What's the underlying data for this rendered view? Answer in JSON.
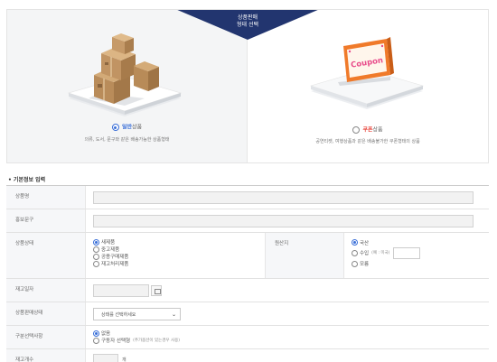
{
  "selection": {
    "banner_line1": "상품판매",
    "banner_line2": "형태 선택",
    "general": {
      "label_highlight": "일반",
      "label_rest": "상품",
      "selected": true,
      "description": "의류, 도서, 문구와 같은 배송가능한 상품형태"
    },
    "coupon": {
      "label_highlight": "쿠폰",
      "label_rest": "상품",
      "selected": false,
      "sign_text": "Coupon",
      "description": "공연티켓, 여행상품과 같은 배송불가한 쿠폰형태의 상품"
    }
  },
  "basic_info": {
    "section_title": "• 기본정보 입력",
    "product_name": {
      "label": "상품명",
      "value": ""
    },
    "promo_text": {
      "label": "홍보문구",
      "value": ""
    },
    "product_state": {
      "label": "상품상태",
      "options": [
        "새제품",
        "중고제품",
        "공용구매제품",
        "재고처리제품"
      ],
      "selected": "새제품"
    },
    "origin": {
      "label": "원산지",
      "options": [
        "국산",
        "수입",
        "모름"
      ],
      "import_hint": "(예 : 미국)",
      "selected": "국산"
    },
    "restock_date": {
      "label": "재고일자",
      "value": ""
    },
    "product_status": {
      "label": "상품판매상태",
      "select_value": "상태를 선택하세요"
    },
    "purchase_options": {
      "label": "구분선택사항",
      "options": [
        "없음",
        "구동자 선택형"
      ],
      "note": "(추가옵션이 있는경우 사용)",
      "selected": "없음"
    },
    "stock_qty": {
      "label": "재고개수",
      "unit": "개"
    }
  },
  "colors": {
    "banner": "#22356f",
    "radio_accent": "#3a6fd8",
    "coupon_accent": "#e8433a",
    "coupon_sign": "#f07a2a"
  }
}
